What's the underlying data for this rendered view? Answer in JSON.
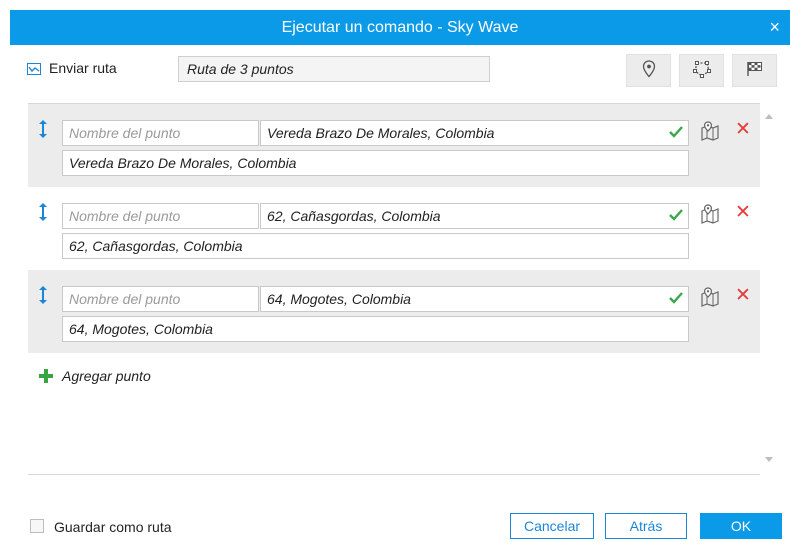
{
  "dialog": {
    "title": "Ejecutar un comando - Sky Wave",
    "close_symbol": "×"
  },
  "command": {
    "label": "Enviar ruta",
    "route_name": "Ruta de 3 puntos"
  },
  "toolbar": {
    "icons": [
      "location-pin-icon",
      "polygon-icon",
      "checkered-flag-icon"
    ]
  },
  "points": [
    {
      "name_placeholder": "Nombre del punto",
      "address": "Vereda Brazo De Morales, Colombia",
      "full_address": "Vereda Brazo De Morales, Colombia"
    },
    {
      "name_placeholder": "Nombre del punto",
      "address": "62, Cañasgordas, Colombia",
      "full_address": "62, Cañasgordas, Colombia"
    },
    {
      "name_placeholder": "Nombre del punto",
      "address": "64, Mogotes, Colombia",
      "full_address": "64, Mogotes, Colombia"
    }
  ],
  "row_actions": {
    "remove_symbol": "✕"
  },
  "add_point": {
    "label": "Agregar punto"
  },
  "footer": {
    "save_as_route_label": "Guardar como ruta",
    "cancel_label": "Cancelar",
    "back_label": "Atrás",
    "ok_label": "OK"
  },
  "colors": {
    "accent": "#0a9ae8",
    "remove": "#e53b3b",
    "check": "#3aa84a",
    "add": "#38a545"
  }
}
